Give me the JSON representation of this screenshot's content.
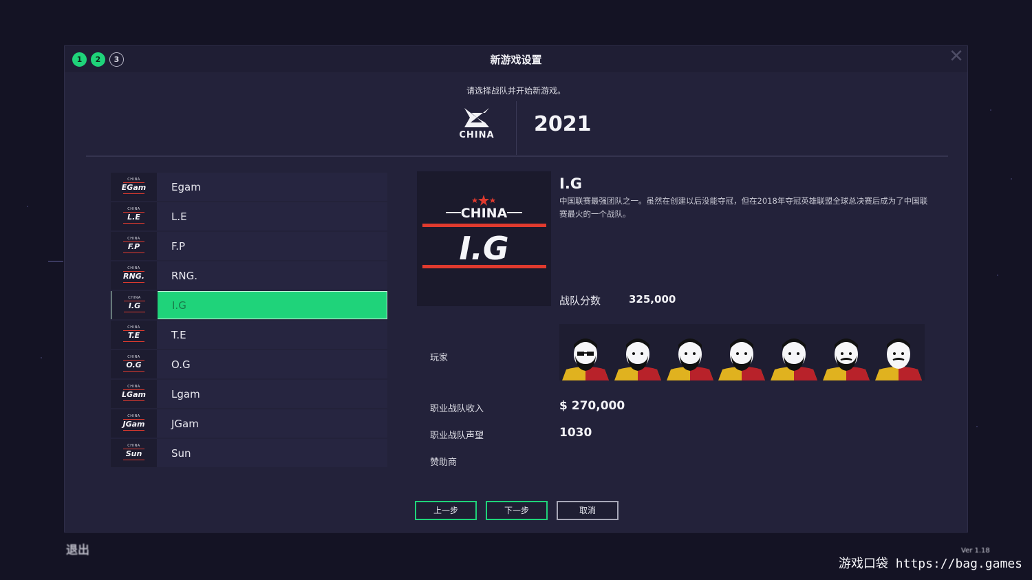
{
  "dialog": {
    "title": "新游戏设置",
    "steps": [
      "1",
      "2",
      "3"
    ],
    "close_label": "✕",
    "subtitle": "请选择战队并开始新游戏。"
  },
  "league": {
    "logo_text": "CHINA",
    "season": "2021"
  },
  "teams": [
    {
      "name": "Egam",
      "short": "EGam",
      "selected": false
    },
    {
      "name": "L.E",
      "short": "L.E",
      "selected": false
    },
    {
      "name": "F.P",
      "short": "F.P",
      "selected": false
    },
    {
      "name": "RNG.",
      "short": "RNG.",
      "selected": false
    },
    {
      "name": "I.G",
      "short": "I.G",
      "selected": true
    },
    {
      "name": "T.E",
      "short": "T.E",
      "selected": false
    },
    {
      "name": "O.G",
      "short": "O.G",
      "selected": false
    },
    {
      "name": "Lgam",
      "short": "LGam",
      "selected": false
    },
    {
      "name": "JGam",
      "short": "JGam",
      "selected": false
    },
    {
      "name": "Sun",
      "short": "Sun",
      "selected": false
    }
  ],
  "team_logo_label": "CHINA",
  "detail": {
    "name": "I.G",
    "logo_top": "CHINA",
    "logo_name": "I.G",
    "description": "中国联赛最强团队之一。虽然在创建以后没能夺冠，但在2018年夺冠英雄联盟全球总决赛后成为了中国联赛最火的一个战队。",
    "score_label": "战队分数",
    "score_value": "325,000",
    "players_label": "玩家",
    "income_label": "职业战队收入",
    "income_value": "$ 270,000",
    "reputation_label": "职业战队声望",
    "reputation_value": "1030",
    "sponsor_label": "赞助商"
  },
  "players": [
    {
      "icon": "sunglasses-beard-avatar"
    },
    {
      "icon": "full-beard-avatar"
    },
    {
      "icon": "full-beard-avatar"
    },
    {
      "icon": "goatee-avatar"
    },
    {
      "icon": "beard-avatar"
    },
    {
      "icon": "mustache-beard-avatar"
    },
    {
      "icon": "mustache-avatar"
    }
  ],
  "buttons": {
    "prev": "上一步",
    "next": "下一步",
    "cancel": "取消"
  },
  "footer": {
    "exit": "退出",
    "version": "Ver 1.18"
  },
  "watermark": {
    "cn": "游戏口袋",
    "url": "https://bag.games"
  },
  "colors": {
    "accent": "#1fd37a",
    "red": "#e03a2e",
    "background": "#141324",
    "panel": "#23223a"
  }
}
